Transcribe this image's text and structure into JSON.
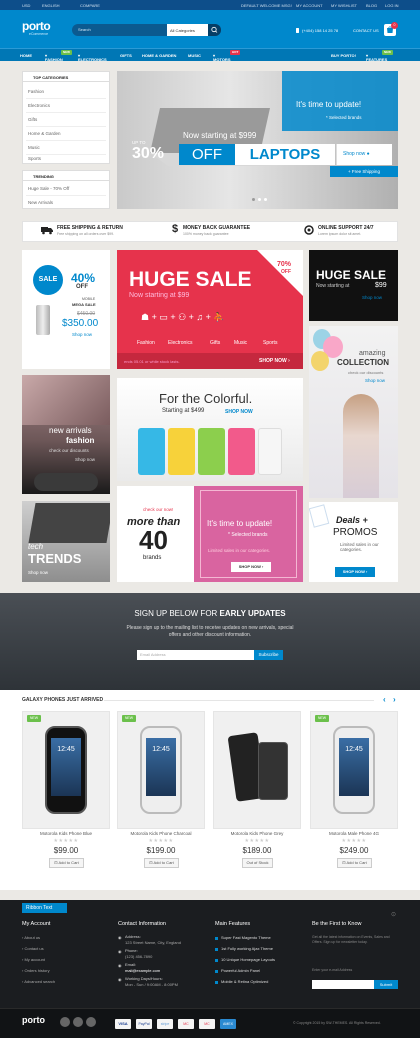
{
  "topbar": {
    "currency": "USD",
    "language": "ENGLISH",
    "compare": "COMPARE",
    "welcome": "DEFAULT WELCOME MSG!",
    "my_account": "MY ACCOUNT",
    "wishlist": "MY WISHLIST",
    "blog": "BLOG",
    "login": "LOG IN"
  },
  "header": {
    "logo": "porto",
    "logo_sub": "eCommerce",
    "search_placeholder": "Search",
    "category": "All Categories",
    "phone": "(+404) 158 14 25 78",
    "contact": "CONTACT US",
    "cart_count": "0"
  },
  "nav": {
    "items": [
      "HOME",
      "FASHION",
      "ELECTRONICS",
      "GIFTS",
      "HOME & GARDEN",
      "MUSIC",
      "MOTORS"
    ],
    "right": [
      "BUY PORTO!",
      "FEATURES"
    ],
    "badge_new": "NEW",
    "badge_hot": "HOT"
  },
  "sidebar": {
    "categories_title": "TOP CATEGORIES",
    "categories": [
      "Fashion",
      "Electronics",
      "Gifts",
      "Home & Garden",
      "Music",
      "Sports"
    ],
    "trending_title": "TRENDING",
    "trending": [
      "Huge Sale - 70% Off",
      "New Arrivals"
    ]
  },
  "hero": {
    "update": "It's time to update!",
    "brands": "* Selected brands",
    "now_starting": "Now starting at $999",
    "upto": "UP TO",
    "pct": "30%",
    "off": "OFF",
    "laptops": "LAPTOPS",
    "shop": "Shop now",
    "free": "+ Free Shipping"
  },
  "services": [
    {
      "title": "FREE SHIPPING & RETURN",
      "sub": "Free shipping on all orders over $99."
    },
    {
      "title": "MONEY BACK GUARANTEE",
      "sub": "100% money back guarantee"
    },
    {
      "title": "ONLINE SUPPORT 24/7",
      "sub": "Lorem ipsum dolor sit amet."
    }
  ],
  "tiles": {
    "sale": {
      "badge": "SALE",
      "pct": "40%",
      "off": "OFF",
      "mobile": "MOBILE",
      "mega": "MEGA SALE",
      "old": "$450.00",
      "price": "$350.00",
      "shop": "Shop now"
    },
    "huge": {
      "title": "HUGE SALE",
      "sub": "Now starting at $99",
      "pct": "70%",
      "off": "OFF",
      "cats": [
        "Fashion",
        "Electronics",
        "Gifts",
        "Music",
        "Sports"
      ],
      "note": "ends 05.01 or while stock lasts.",
      "shop": "SHOP NOW"
    },
    "huge2": {
      "title": "HUGE SALE",
      "sub": "Now starting at",
      "price": "$99",
      "shop": "Shop now"
    },
    "fashion": {
      "line1": "new arrivals",
      "line2": "fashion",
      "line3": "check our discounts",
      "shop": "Shop now"
    },
    "colorful": {
      "title": "For the Colorful.",
      "starting": "Starting at $499",
      "shop": "SHOP NOW"
    },
    "collection": {
      "line1": "amazing",
      "line2": "COLLECTION",
      "line3": "check our discounts",
      "shop": "Shop now"
    },
    "tech": {
      "line1": "tech",
      "line2": "TRENDS",
      "shop": "Shop now"
    },
    "morethan": {
      "check": "check our now!",
      "more": "more than",
      "num": "40",
      "brands": "brands"
    },
    "update2": {
      "title": "It's time to update!",
      "brands": "* Selected brands",
      "limited": "Limited sales in our categories.",
      "shop": "SHOP NOW"
    },
    "deals": {
      "title": "Deals +",
      "promos": "PROMOS",
      "limited": "Limited sales in our categories.",
      "shop": "SHOP NOW"
    }
  },
  "newsletter": {
    "title_a": "SIGN UP BELOW FOR ",
    "title_b": "EARLY UPDATES",
    "desc": "Please sign up to the mailing list to receive updates on new arrivals, special offers and other discount information.",
    "placeholder": "Email Address",
    "button": "Subscribe"
  },
  "products": {
    "title": "GALAXY PHONES JUST ARRIVED",
    "badge": "NEW",
    "items": [
      {
        "name": "Motorola Kids Phone Blue",
        "price": "$99.00",
        "button": "Add to Cart",
        "time": "12:45"
      },
      {
        "name": "Motorola Kids Phone Charcoal",
        "price": "$199.00",
        "button": "Add to Cart",
        "time": "12:45"
      },
      {
        "name": "Motorola Kids Phone Grey",
        "price": "$189.00",
        "button": "Out of Stock",
        "time": ""
      },
      {
        "name": "Motorola Male Phone 4G",
        "price": "$249.00",
        "button": "Add to Cart",
        "time": "12:45"
      }
    ]
  },
  "footer": {
    "ribbon": "Ribbon Text",
    "account_title": "My Account",
    "account": [
      "About us",
      "Contact us",
      "My account",
      "Orders history",
      "Advanced search"
    ],
    "contact_title": "Contact Information",
    "address_label": "Address:",
    "address": "123 Street Name, City, England",
    "phone_label": "Phone:",
    "phone": "(123) 456-7890",
    "email_label": "Email:",
    "email": "mail@example.com",
    "hours_label": "Working Days/Hours:",
    "hours": "Mon - Sun / 9:00AM - 8:00PM",
    "features_title": "Main Features",
    "features": [
      "Super Fast Magento Theme",
      "1st Fully working Ajax Theme",
      "10 Unique Homepage Layouts",
      "Powerful Admin Panel",
      "Mobile & Retina Optimized"
    ],
    "know_title": "Be the First to Know",
    "know_text": "Get all the latest information on Events, Sales and Offers. Sign up for newsletter today.",
    "email_placeholder": "Enter your e-mail Address",
    "submit": "Submit",
    "logo": "porto",
    "copyright": "© Copyright 2015 by SW-THEMES. All Rights Reserved.",
    "payments": [
      "VISA",
      "PayPal",
      "stripe",
      "MC",
      "MC",
      "AMEX"
    ]
  }
}
